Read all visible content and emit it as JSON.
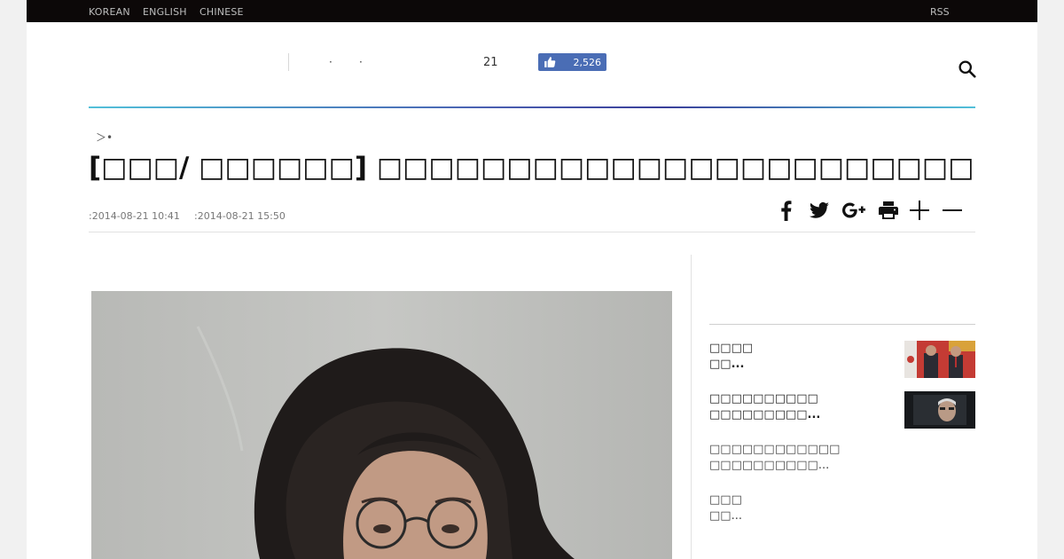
{
  "topbar": {
    "languages": [
      "KOREAN",
      "ENGLISH",
      "CHINESE"
    ],
    "rss": "RSS"
  },
  "header": {
    "dots": [
      "·",
      "·"
    ],
    "count": "21",
    "like_count": "2,526"
  },
  "article": {
    "breadcrumb": "＞•",
    "headline": "[□□□/ □□□□□□] □□□□□□□□□□□□□□□□□□□□□□□□□□□□□□□",
    "published": ":2014-08-21 10:41",
    "updated": ":2014-08-21 15:50"
  },
  "sidebar": {
    "items": [
      {
        "line1": "□□□□",
        "line2": "□□..."
      },
      {
        "line1": "□□□□□□□□□□",
        "line2": "□□□□□□□□□..."
      },
      {
        "line1": "□□□□□□□□□□□□",
        "line2": "□□□□□□□□□□..."
      },
      {
        "line1": "□□□",
        "line2": "□□..."
      }
    ]
  },
  "colors": {
    "topbar_bg": "#0c0808",
    "facebook_like": "#4a6db5",
    "accent_line_start": "#52c0d9",
    "accent_line_mid": "#3a3f9a"
  },
  "icons": [
    "thumbs-up-icon",
    "search-icon",
    "facebook-icon",
    "twitter-icon",
    "google-plus-icon",
    "print-icon",
    "zoom-in-icon",
    "zoom-out-icon"
  ]
}
